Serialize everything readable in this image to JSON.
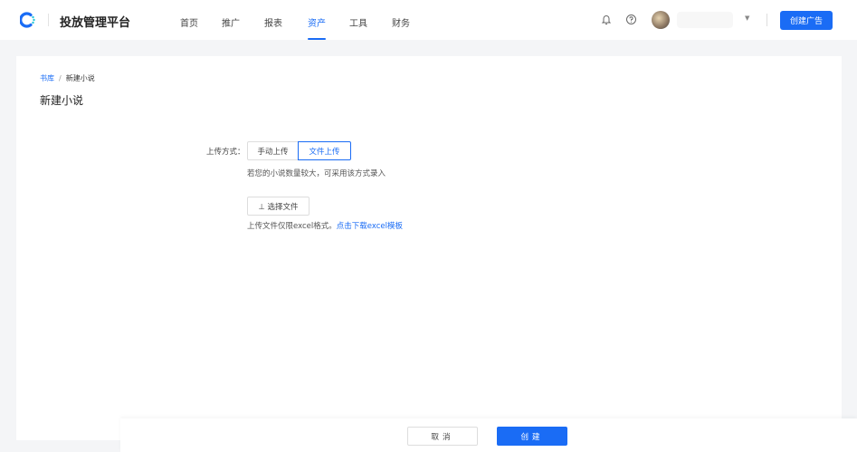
{
  "header": {
    "app_title": "投放管理平台",
    "nav": [
      {
        "label": "首页"
      },
      {
        "label": "推广"
      },
      {
        "label": "报表"
      },
      {
        "label": "资产",
        "active": true
      },
      {
        "label": "工具"
      },
      {
        "label": "财务"
      }
    ],
    "create_ad_label": "创建广告",
    "accent": "#1a6cf5"
  },
  "breadcrumb": {
    "parent": "书库",
    "separator": "/",
    "current": "新建小说"
  },
  "page_title": "新建小说",
  "form": {
    "upload_method_label": "上传方式：",
    "options": [
      {
        "label": "手动上传",
        "selected": false
      },
      {
        "label": "文件上传",
        "selected": true
      }
    ],
    "hint": "若您的小说数量较大，可采用该方式录入",
    "select_file_label": "选择文件",
    "note": "上传文件仅限excel格式。",
    "download_link": "点击下载excel模板"
  },
  "footer": {
    "cancel_label": "取消",
    "create_label": "创建"
  }
}
